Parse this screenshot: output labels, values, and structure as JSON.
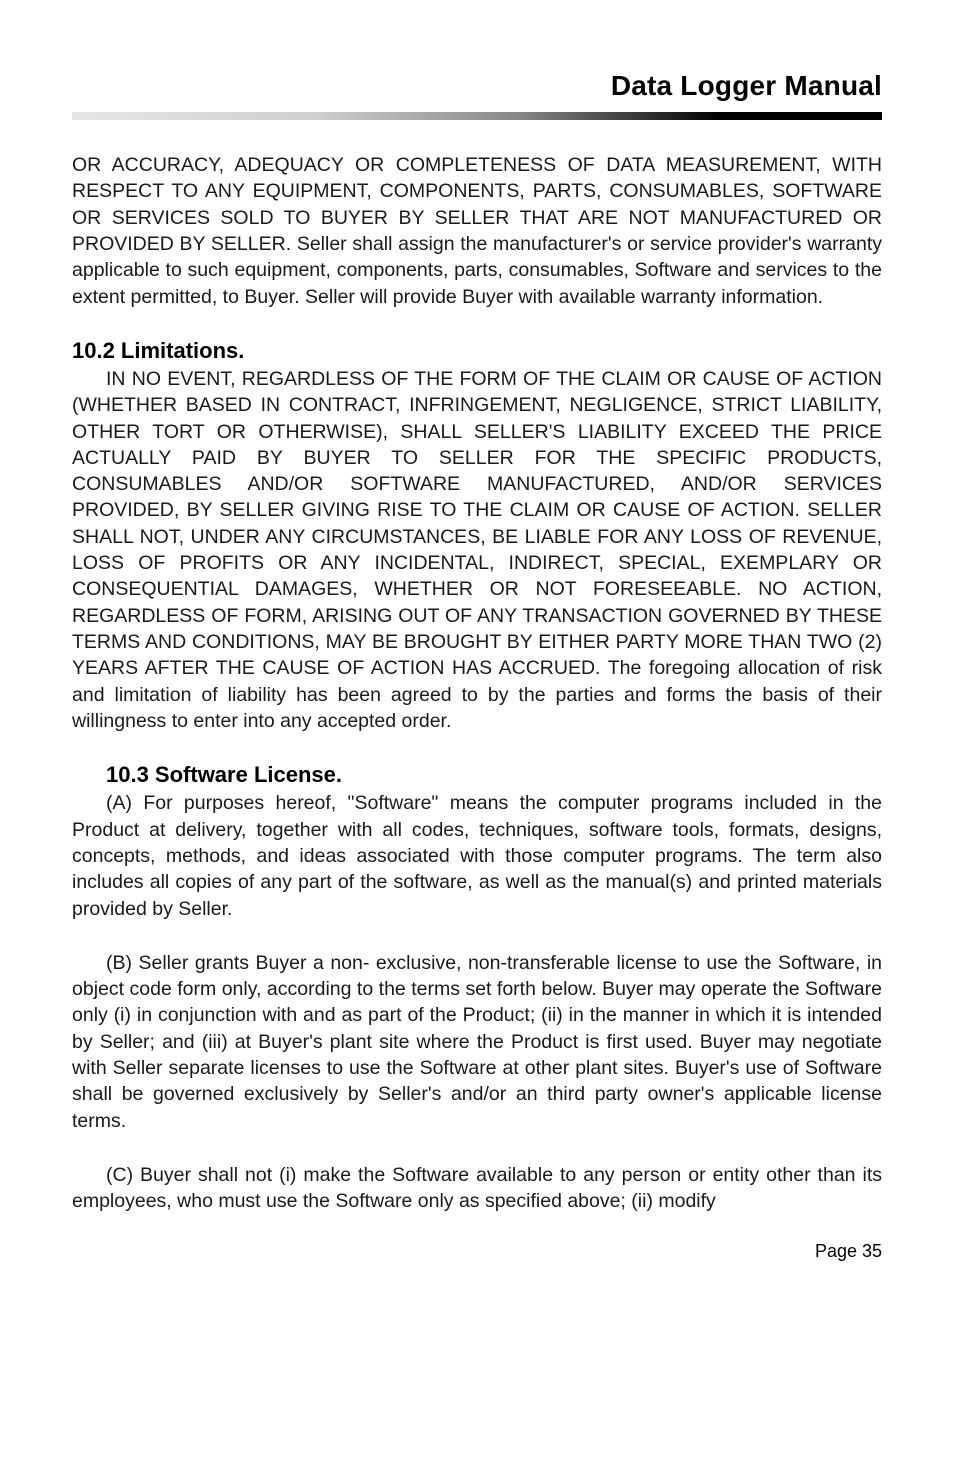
{
  "header": {
    "title": "Data Logger Manual"
  },
  "paragraphs": {
    "p1": "OR ACCURACY, ADEQUACY OR COMPLETENESS OF DATA MEASUREMENT, WITH RESPECT TO ANY EQUIPMENT, COMPONENTS, PARTS, CONSUMABLES, SOFTWARE OR SERVICES SOLD TO BUYER BY SELLER THAT ARE NOT MANUFACTURED OR PROVIDED BY SELLER. Seller shall assign the manufacturer's or service provider's warranty applicable to such equipment, components, parts, consumables, Software and services to the extent permitted, to Buyer. Seller will provide Buyer with available warranty information.",
    "h102": "10.2 Limitations.",
    "p2": "IN NO EVENT, REGARDLESS OF THE FORM OF THE CLAIM OR CAUSE OF ACTION (WHETHER BASED IN CONTRACT, INFRINGEMENT, NEGLIGENCE, STRICT LIABILITY, OTHER TORT OR OTHERWISE), SHALL SELLER'S LIABILITY EXCEED THE PRICE ACTUALLY PAID BY BUYER TO SELLER FOR THE SPECIFIC PRODUCTS, CONSUMABLES AND/OR SOFTWARE MANUFACTURED, AND/OR SERVICES PROVIDED, BY SELLER GIVING RISE TO THE CLAIM OR CAUSE OF ACTION. SELLER SHALL NOT, UNDER ANY CIRCUMSTANCES, BE LIABLE FOR ANY LOSS OF REVENUE, LOSS OF PROFITS OR ANY INCIDENTAL, INDIRECT, SPECIAL, EXEMPLARY OR CONSEQUENTIAL DAMAGES, WHETHER OR NOT FORESEEABLE. NO ACTION, REGARDLESS OF FORM, ARISING OUT OF ANY TRANSACTION GOVERNED BY THESE TERMS AND CONDITIONS, MAY BE BROUGHT BY EITHER PARTY MORE THAN TWO (2) YEARS AFTER THE CAUSE OF ACTION HAS ACCRUED. The foregoing allocation of risk and limitation of liability has been agreed to by the parties and forms the basis of their willingness to enter into any accepted order.",
    "h103": "10.3 Software License.",
    "p3": "(A) For purposes hereof, \"Software\" means the computer programs included in the Product at delivery, together with all codes, techniques, software tools, formats, designs, concepts, methods, and ideas associated with those computer programs. The term also includes all copies of any part of the software, as well as the manual(s) and printed materials provided by Seller.",
    "p4": "(B) Seller grants Buyer a non- exclusive, non-transferable license to use the Software, in object code form only, according to the terms set forth below. Buyer may operate the Software only (i) in conjunction with and as part of the Product; (ii) in the manner in which it is intended by Seller; and (iii) at Buyer's plant site where the Product is first used. Buyer may negotiate with Seller separate licenses to use the Software at other plant sites. Buyer's use of Software shall be governed exclusively by Seller's and/or an third party owner's applicable license terms.",
    "p5": "(C) Buyer shall not (i) make the Software available to any person or entity other than its employees, who must use the Software only as specified above; (ii) modify"
  },
  "footer": {
    "page_label": "Page 35"
  }
}
